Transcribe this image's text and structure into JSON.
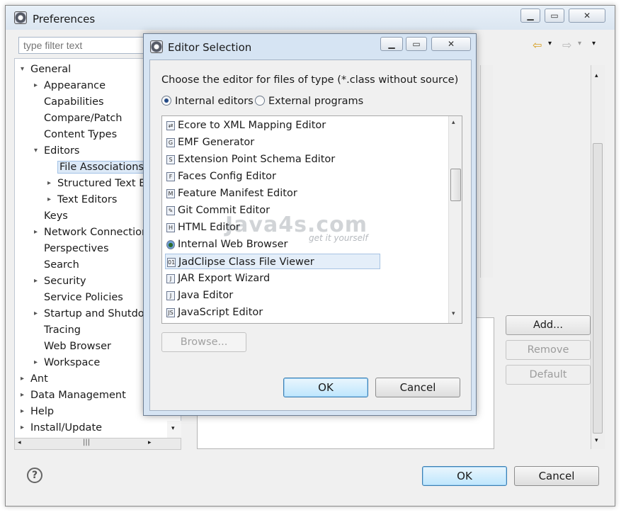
{
  "prefs": {
    "title": "Preferences",
    "filter_placeholder": "type filter text",
    "tree": [
      {
        "label": "General",
        "level": 0,
        "arrow": "▾"
      },
      {
        "label": "Appearance",
        "level": 1,
        "arrow": "▸"
      },
      {
        "label": "Capabilities",
        "level": 1,
        "arrow": ""
      },
      {
        "label": "Compare/Patch",
        "level": 1,
        "arrow": ""
      },
      {
        "label": "Content Types",
        "level": 1,
        "arrow": ""
      },
      {
        "label": "Editors",
        "level": 1,
        "arrow": "▾"
      },
      {
        "label": "File Associations",
        "level": 2,
        "arrow": "",
        "selected": true
      },
      {
        "label": "Structured Text Ec",
        "level": 2,
        "arrow": "▸"
      },
      {
        "label": "Text Editors",
        "level": 2,
        "arrow": "▸"
      },
      {
        "label": "Keys",
        "level": 1,
        "arrow": ""
      },
      {
        "label": "Network Connection",
        "level": 1,
        "arrow": "▸"
      },
      {
        "label": "Perspectives",
        "level": 1,
        "arrow": ""
      },
      {
        "label": "Search",
        "level": 1,
        "arrow": ""
      },
      {
        "label": "Security",
        "level": 1,
        "arrow": "▸"
      },
      {
        "label": "Service Policies",
        "level": 1,
        "arrow": ""
      },
      {
        "label": "Startup and Shutdov",
        "level": 1,
        "arrow": "▸"
      },
      {
        "label": "Tracing",
        "level": 1,
        "arrow": ""
      },
      {
        "label": "Web Browser",
        "level": 1,
        "arrow": ""
      },
      {
        "label": "Workspace",
        "level": 1,
        "arrow": "▸"
      },
      {
        "label": "Ant",
        "level": 0,
        "arrow": "▸"
      },
      {
        "label": "Data Management",
        "level": 0,
        "arrow": "▸"
      },
      {
        "label": "Help",
        "level": 0,
        "arrow": "▸"
      },
      {
        "label": "Install/Update",
        "level": 0,
        "arrow": "▸"
      }
    ],
    "add_label": "Add...",
    "remove_label": "Remove",
    "default_label": "Default",
    "ok_label": "OK",
    "cancel_label": "Cancel",
    "help_glyph": "?"
  },
  "dialog": {
    "title": "Editor Selection",
    "prompt": "Choose the editor for files of type (*.class without source)",
    "radio_internal": "Internal editors",
    "radio_external": "External programs",
    "editors": [
      {
        "label": "Ecore to XML Mapping Editor",
        "icon": "mapping-icon"
      },
      {
        "label": "EMF Generator",
        "icon": "generator-icon"
      },
      {
        "label": "Extension Point Schema Editor",
        "icon": "schema-icon"
      },
      {
        "label": "Faces Config Editor",
        "icon": "faces-icon"
      },
      {
        "label": "Feature Manifest Editor",
        "icon": "feature-icon"
      },
      {
        "label": "Git Commit Editor",
        "icon": "git-icon"
      },
      {
        "label": "HTML Editor",
        "icon": "html-icon"
      },
      {
        "label": "Internal Web Browser",
        "icon": "globe-icon"
      },
      {
        "label": "JadClipse Class File Viewer",
        "icon": "class-file-icon",
        "selected": true
      },
      {
        "label": "JAR Export Wizard",
        "icon": "jar-icon"
      },
      {
        "label": "Java Editor",
        "icon": "java-icon"
      },
      {
        "label": "JavaScript Editor",
        "icon": "javascript-icon"
      }
    ],
    "browse_label": "Browse...",
    "ok_label": "OK",
    "cancel_label": "Cancel"
  },
  "watermark": {
    "main": "Java4s.com",
    "tagline": "get it yourself"
  }
}
